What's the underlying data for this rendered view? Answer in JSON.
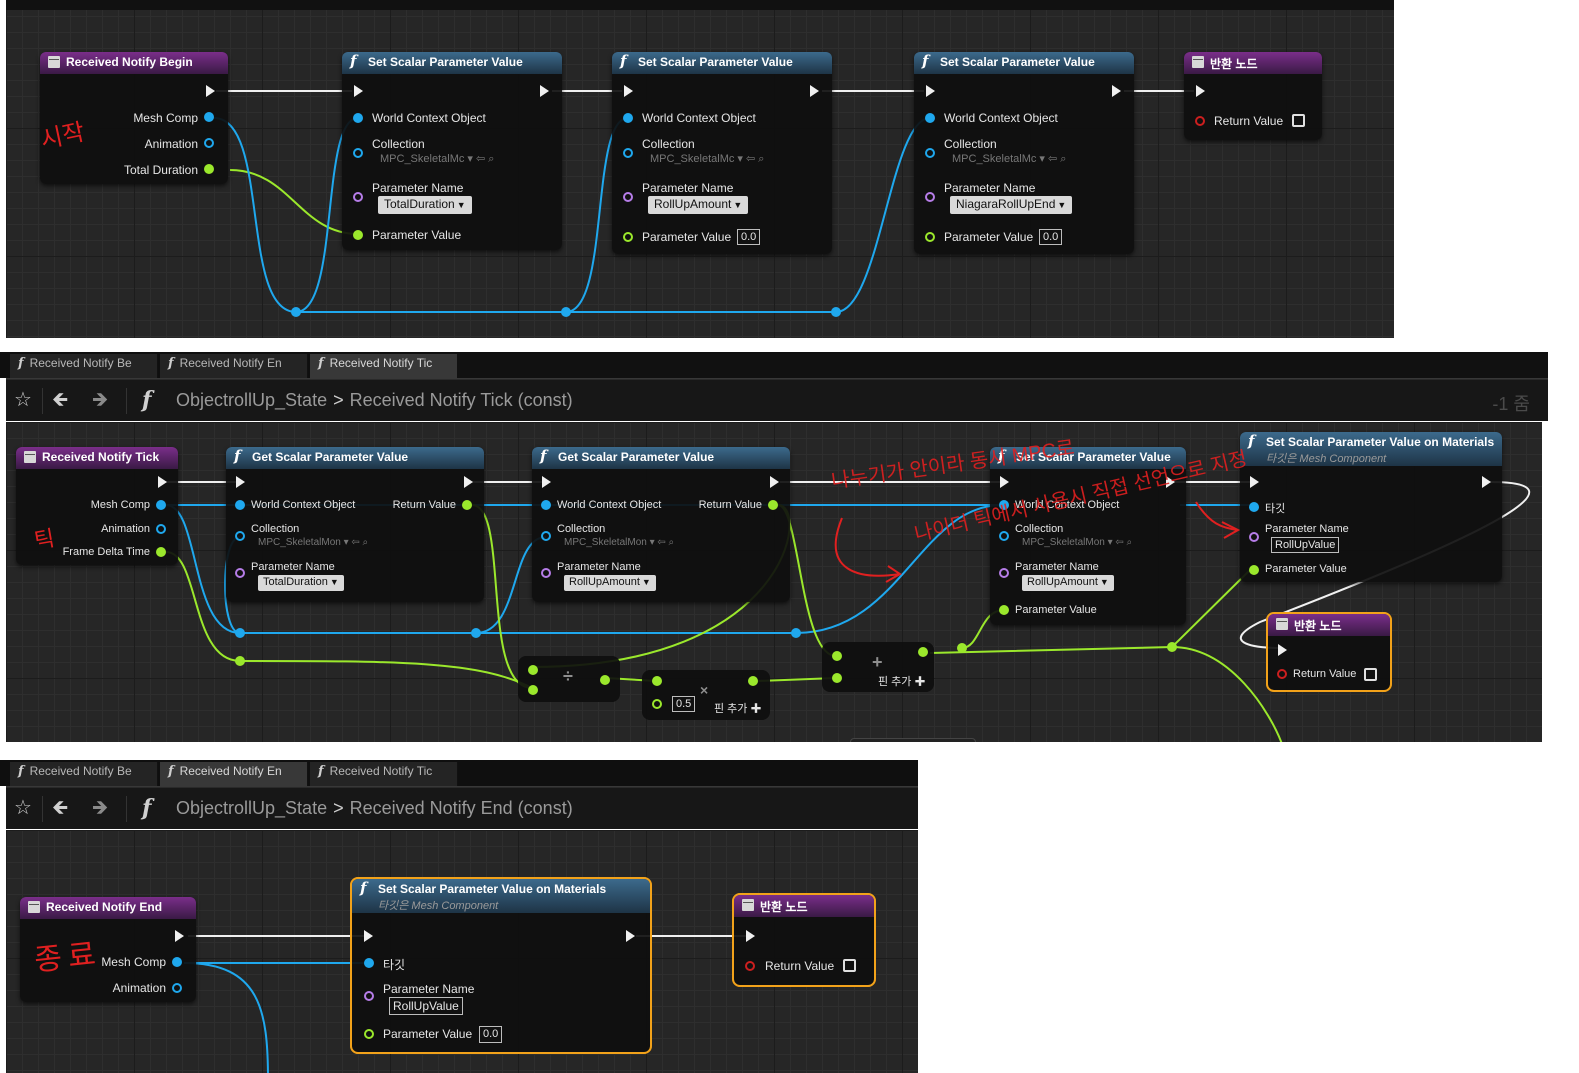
{
  "panel_top": {
    "node_begin": {
      "title": "Received Notify Begin",
      "pins": [
        "Mesh Comp",
        "Animation",
        "Total Duration"
      ]
    },
    "set1": {
      "title": "Set Scalar Parameter Value",
      "world": "World Context Object",
      "collection_label": "Collection",
      "collection_value": "MPC_SkeletalMc",
      "param_name_label": "Parameter Name",
      "param_name_value": "TotalDuration",
      "param_value_label": "Parameter Value"
    },
    "set2": {
      "title": "Set Scalar Parameter Value",
      "world": "World Context Object",
      "collection_label": "Collection",
      "collection_value": "MPC_SkeletalMc",
      "param_name_label": "Parameter Name",
      "param_name_value": "RollUpAmount",
      "param_value_label": "Parameter Value",
      "param_value": "0.0"
    },
    "set3": {
      "title": "Set Scalar Parameter Value",
      "world": "World Context Object",
      "collection_label": "Collection",
      "collection_value": "MPC_SkeletalMc",
      "param_name_label": "Parameter Name",
      "param_name_value": "NiagaraRollUpEnd",
      "param_value_label": "Parameter Value",
      "param_value": "0.0"
    },
    "return": {
      "title": "반환 노드",
      "pin": "Return Value"
    },
    "annotation": "시작"
  },
  "panel_mid": {
    "tabs": [
      "Received Notify Be",
      "Received Notify En",
      "Received Notify Tic"
    ],
    "breadcrumb": {
      "blueprint": "ObjectrollUp_State",
      "function": "Received Notify Tick (const)"
    },
    "zoom": "-1 줌",
    "node_tick": {
      "title": "Received Notify Tick",
      "pins": [
        "Mesh Comp",
        "Animation",
        "Frame Delta Time"
      ]
    },
    "get1": {
      "title": "Get Scalar Parameter Value",
      "world": "World Context Object",
      "ret": "Return Value",
      "collection_label": "Collection",
      "collection_value": "MPC_SkeletalMon",
      "param_name_label": "Parameter Name",
      "param_name_value": "TotalDuration"
    },
    "get2": {
      "title": "Get Scalar Parameter Value",
      "world": "World Context Object",
      "ret": "Return Value",
      "collection_label": "Collection",
      "collection_value": "MPC_SkeletalMon",
      "param_name_label": "Parameter Name",
      "param_name_value": "RollUpAmount"
    },
    "set": {
      "title": "Set Scalar Parameter Value",
      "world": "World Context Object",
      "collection_label": "Collection",
      "collection_value": "MPC_SkeletalMon",
      "param_name_label": "Parameter Name",
      "param_name_value": "RollUpAmount",
      "param_value_label": "Parameter Value"
    },
    "set_mat": {
      "title": "Set Scalar Parameter Value on Materials",
      "subtitle": "타깃은 Mesh Component",
      "target": "타깃",
      "param_name_label": "Parameter Name",
      "param_name_value": "RollUpValue",
      "param_value_label": "Parameter Value"
    },
    "return": {
      "title": "반환 노드",
      "pin": "Return Value"
    },
    "divide": {
      "glyph": "÷"
    },
    "multiply": {
      "glyph": "×",
      "value": "0.5",
      "add_pin": "핀 추가"
    },
    "add": {
      "glyph": "+",
      "add_pin": "핀 추가"
    },
    "annotations": {
      "left": "틱",
      "line1": "나누기가 안이라 동시 MPC로",
      "line2": "나이더 틱에서 사용시 직접 선언으로 지정"
    }
  },
  "panel_bot": {
    "tabs": [
      "Received Notify Be",
      "Received Notify En",
      "Received Notify Tic"
    ],
    "breadcrumb": {
      "blueprint": "ObjectrollUp_State",
      "function": "Received Notify End (const)"
    },
    "node_end": {
      "title": "Received Notify End",
      "pins": [
        "Mesh Comp",
        "Animation"
      ]
    },
    "set_mat": {
      "title": "Set Scalar Parameter Value on Materials",
      "subtitle": "타깃은 Mesh Component",
      "target": "타깃",
      "param_name_label": "Parameter Name",
      "param_name_value": "RollUpValue",
      "param_value_label": "Parameter Value",
      "param_value": "0.0"
    },
    "return": {
      "title": "반환 노드",
      "pin": "Return Value"
    },
    "annotation": "종료"
  },
  "colors": {
    "exec": "#f0f0f0",
    "object_pin": "#1fa8ee",
    "float_pin": "#9be82c",
    "name_pin": "#b67de8",
    "bool_pin": "#cc1f1f",
    "selection": "#f2a21a",
    "annotation": "#e02020"
  },
  "icons": [
    "star-icon",
    "back-arrow-icon",
    "forward-arrow-icon",
    "function-icon",
    "event-icon"
  ]
}
